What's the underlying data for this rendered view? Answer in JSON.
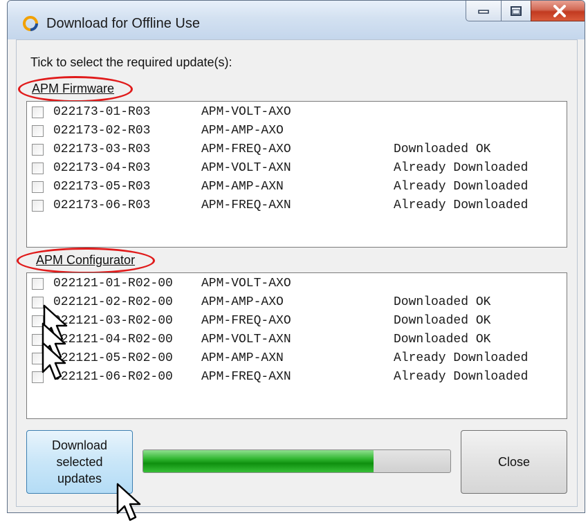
{
  "window": {
    "title": "Download for Offline Use",
    "controls": [
      "minimize-icon",
      "maximize-icon",
      "close-icon"
    ]
  },
  "instruction": "Tick to select the required update(s):",
  "firmware": {
    "label": "APM Firmware",
    "items": [
      {
        "code": "022173-01-R03",
        "name": "APM-VOLT-AXO",
        "status": ""
      },
      {
        "code": "022173-02-R03",
        "name": "APM-AMP-AXO",
        "status": ""
      },
      {
        "code": "022173-03-R03",
        "name": "APM-FREQ-AXO",
        "status": "Downloaded OK"
      },
      {
        "code": "022173-04-R03",
        "name": "APM-VOLT-AXN",
        "status": "Already Downloaded"
      },
      {
        "code": "022173-05-R03",
        "name": "APM-AMP-AXN",
        "status": "Already Downloaded"
      },
      {
        "code": "022173-06-R03",
        "name": "APM-FREQ-AXN",
        "status": "Already Downloaded"
      }
    ]
  },
  "configurator": {
    "label": "APM Configurator",
    "items": [
      {
        "code": "022121-01-R02-00",
        "name": "APM-VOLT-AXO",
        "status": ""
      },
      {
        "code": "022121-02-R02-00",
        "name": "APM-AMP-AXO",
        "status": "Downloaded OK"
      },
      {
        "code": "022121-03-R02-00",
        "name": "APM-FREQ-AXO",
        "status": "Downloaded OK"
      },
      {
        "code": "022121-04-R02-00",
        "name": "APM-VOLT-AXN",
        "status": "Downloaded OK"
      },
      {
        "code": "022121-05-R02-00",
        "name": "APM-AMP-AXN",
        "status": "Already Downloaded"
      },
      {
        "code": "022121-06-R02-00",
        "name": "APM-FREQ-AXN",
        "status": "Already Downloaded"
      }
    ]
  },
  "buttons": {
    "download_line1": "Download",
    "download_line2": "selected",
    "download_line3": "updates",
    "close": "Close"
  },
  "progress": {
    "fraction": 0.75
  },
  "colors": {
    "annotation": "#e01b1b",
    "progress": "#1fa51f"
  }
}
